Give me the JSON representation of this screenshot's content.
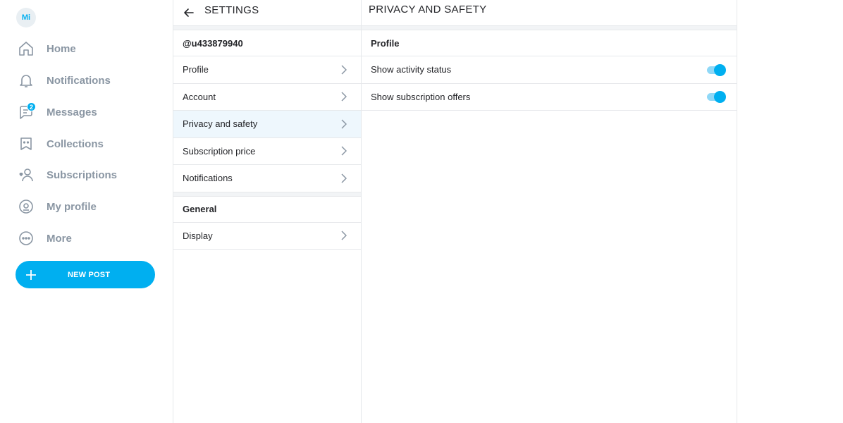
{
  "user": {
    "avatar_initials": "Mi",
    "handle": "@u433879940"
  },
  "nav": {
    "items": [
      {
        "label": "Home",
        "icon": "home-icon"
      },
      {
        "label": "Notifications",
        "icon": "bell-icon"
      },
      {
        "label": "Messages",
        "icon": "chat-icon",
        "badge": "2"
      },
      {
        "label": "Collections",
        "icon": "bookmark-icon"
      },
      {
        "label": "Subscriptions",
        "icon": "user-heart-icon"
      },
      {
        "label": "My profile",
        "icon": "profile-icon"
      },
      {
        "label": "More",
        "icon": "more-icon"
      }
    ],
    "new_post_label": "NEW POST"
  },
  "settings": {
    "title": "SETTINGS",
    "account_items": [
      {
        "label": "Profile"
      },
      {
        "label": "Account"
      },
      {
        "label": "Privacy and safety"
      },
      {
        "label": "Subscription price"
      },
      {
        "label": "Notifications"
      }
    ],
    "general_header": "General",
    "general_items": [
      {
        "label": "Display"
      }
    ]
  },
  "privacy": {
    "title": "PRIVACY AND SAFETY",
    "section_header": "Profile",
    "toggles": [
      {
        "label": "Show activity status",
        "enabled": true
      },
      {
        "label": "Show subscription offers",
        "enabled": true
      }
    ]
  },
  "colors": {
    "accent": "#00aff0",
    "nav_text": "#8a96a3",
    "active_row": "#eef7fd"
  }
}
